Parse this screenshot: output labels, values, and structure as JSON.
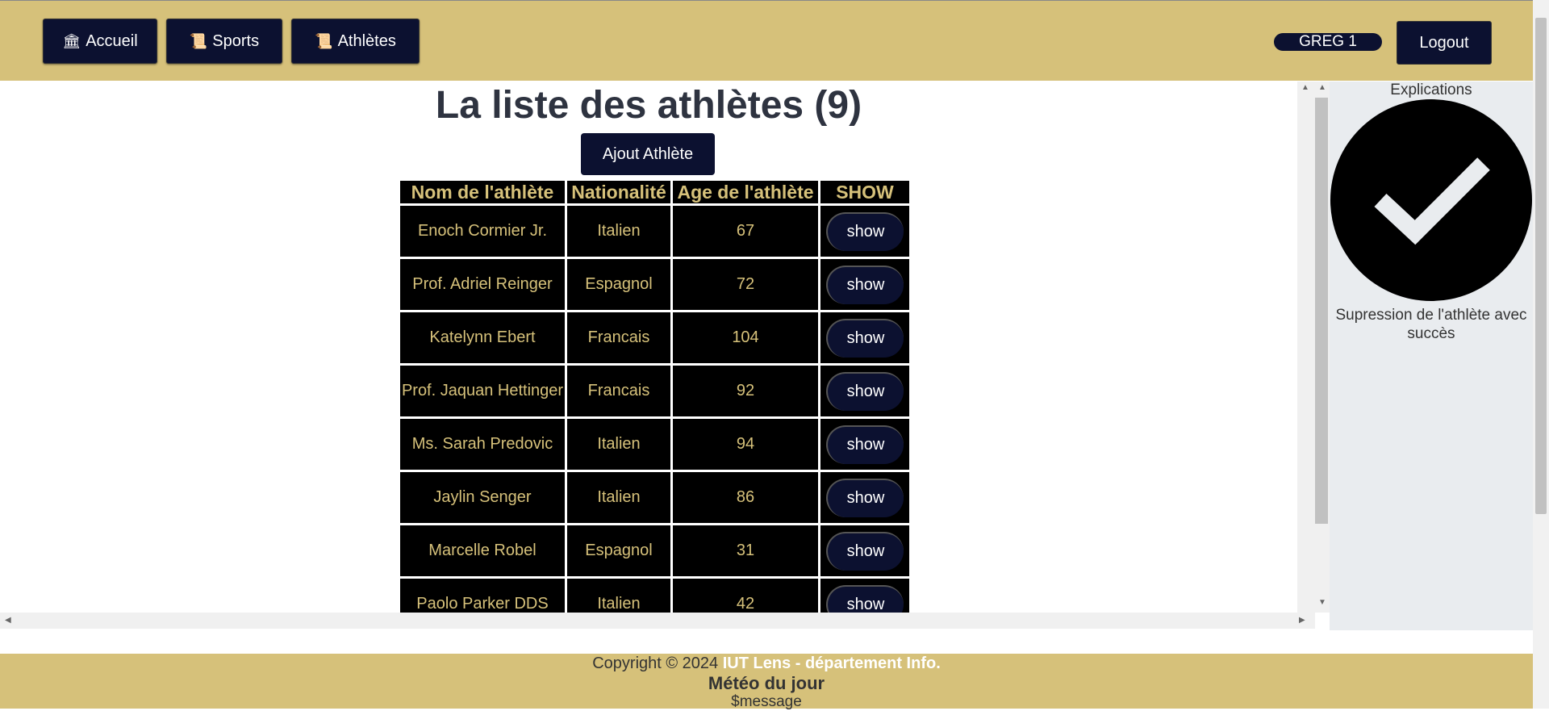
{
  "nav": {
    "home_icon": "🏛",
    "home_label": "Accueil",
    "sports_icon": "📜",
    "sports_label": "Sports",
    "athletes_icon": "📜",
    "athletes_label": "Athlètes",
    "user": "GREG 1",
    "logout": "Logout"
  },
  "main": {
    "title": "La liste des athlètes (9)",
    "add_button": "Ajout Athlète",
    "table": {
      "headers": [
        "Nom de l'athlète",
        "Nationalité",
        "Age de l'athlète",
        "SHOW"
      ],
      "rows": [
        {
          "name": "Enoch Cormier Jr.",
          "nationality": "Italien",
          "age": "67",
          "action": "show"
        },
        {
          "name": "Prof. Adriel Reinger",
          "nationality": "Espagnol",
          "age": "72",
          "action": "show"
        },
        {
          "name": "Katelynn Ebert",
          "nationality": "Francais",
          "age": "104",
          "action": "show"
        },
        {
          "name": "Prof. Jaquan Hettinger",
          "nationality": "Francais",
          "age": "92",
          "action": "show"
        },
        {
          "name": "Ms. Sarah Predovic",
          "nationality": "Italien",
          "age": "94",
          "action": "show"
        },
        {
          "name": "Jaylin Senger",
          "nationality": "Italien",
          "age": "86",
          "action": "show"
        },
        {
          "name": "Marcelle Robel",
          "nationality": "Espagnol",
          "age": "31",
          "action": "show"
        },
        {
          "name": "Paolo Parker DDS",
          "nationality": "Italien",
          "age": "42",
          "action": "show"
        }
      ]
    }
  },
  "sidebar": {
    "title": "Explications",
    "icon": "check-circle-icon",
    "message": "Supression de l'athlète avec succès"
  },
  "footer": {
    "copyright_prefix": "Copyright © 2024",
    "copyright_org": "IUT Lens - département Info.",
    "meteo_title": "Météo du jour",
    "meteo_message": "$message"
  },
  "colors": {
    "bar": "#d6c17a",
    "button": "#0c1130",
    "table_bg": "#000000",
    "table_text": "#d6c17a"
  }
}
